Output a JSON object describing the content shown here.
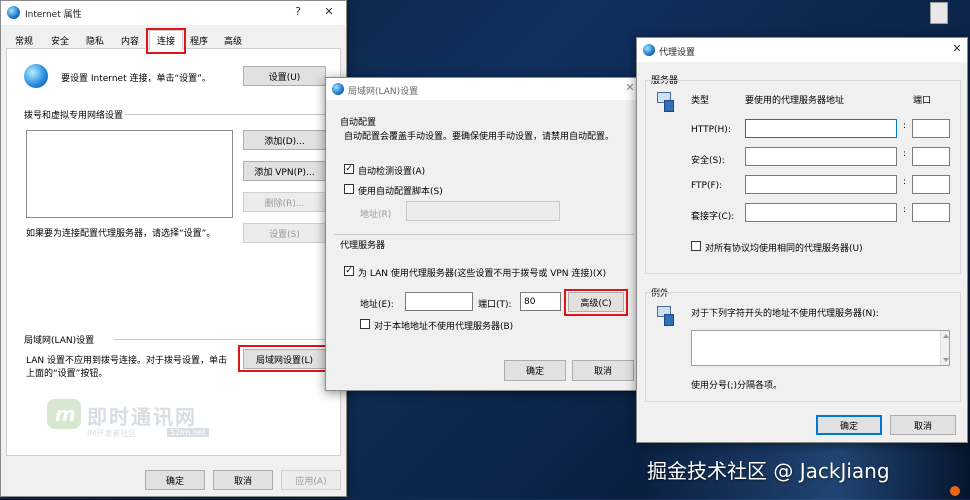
{
  "internet_props": {
    "title": "Internet 属性",
    "help": "?",
    "close": "✕",
    "tabs": [
      "常规",
      "安全",
      "隐私",
      "内容",
      "连接",
      "程序",
      "高级"
    ],
    "setup_text": "要设置 Internet 连接，单击“设置”。",
    "setup_button": "设置(U)",
    "dialup_header": "拨号和虚拟专用网络设置",
    "add_button": "添加(D)...",
    "add_vpn_button": "添加 VPN(P)...",
    "remove_button": "删除(R)...",
    "settings_button": "设置(S)",
    "proxy_hint": "如果要为连接配置代理服务器，请选择“设置”。",
    "lan_header": "局域网(LAN)设置",
    "lan_text_1": "LAN 设置不应用到拨号连接。对于拨号设置，单击",
    "lan_text_2": "上面的“设置”按钮。",
    "lan_button": "局域网设置(L)",
    "ok": "确定",
    "cancel": "取消",
    "apply": "应用(A)"
  },
  "watermark": {
    "logo_letter": "m",
    "brand": "即时通讯网",
    "sub": "IM开发者社区",
    "domain": "52im.net"
  },
  "lan_dialog": {
    "title": "局域网(LAN)设置",
    "close": "✕",
    "auto_header": "自动配置",
    "auto_desc": "自动配置会覆盖手动设置。要确保使用手动设置，请禁用自动配置。",
    "auto_detect_label": "自动检测设置(A)",
    "auto_detect_checked": "✓",
    "use_script_label": "使用自动配置脚本(S)",
    "address_label": "地址(R)",
    "proxy_header": "代理服务器",
    "use_proxy_label": "为 LAN 使用代理服务器(这些设置不用于拨号或 VPN 连接)(X)",
    "use_proxy_checked": "✓",
    "addr_label": "地址(E):",
    "port_label": "端口(T):",
    "port_value": "80",
    "advanced_button": "高级(C)",
    "bypass_label": "对于本地地址不使用代理服务器(B)",
    "ok": "确定",
    "cancel": "取消"
  },
  "proxy_dialog": {
    "title": "代理设置",
    "close": "✕",
    "servers_header": "服务器",
    "col_type": "类型",
    "col_address": "要使用的代理服务器地址",
    "col_port": "端口",
    "rows": [
      {
        "label": "HTTP(H):"
      },
      {
        "label": "安全(S):"
      },
      {
        "label": "FTP(F):"
      },
      {
        "label": "套接字(C):"
      }
    ],
    "colon": ":",
    "same_proxy_label": "对所有协议均使用相同的代理服务器(U)",
    "exceptions_header": "例外",
    "exceptions_desc": "对于下列字符开头的地址不使用代理服务器(N):",
    "separator_hint": "使用分号(;)分隔各项。",
    "ok": "确定",
    "cancel": "取消"
  },
  "footer_watermark": "掘金技术社区 @ JackJiang"
}
